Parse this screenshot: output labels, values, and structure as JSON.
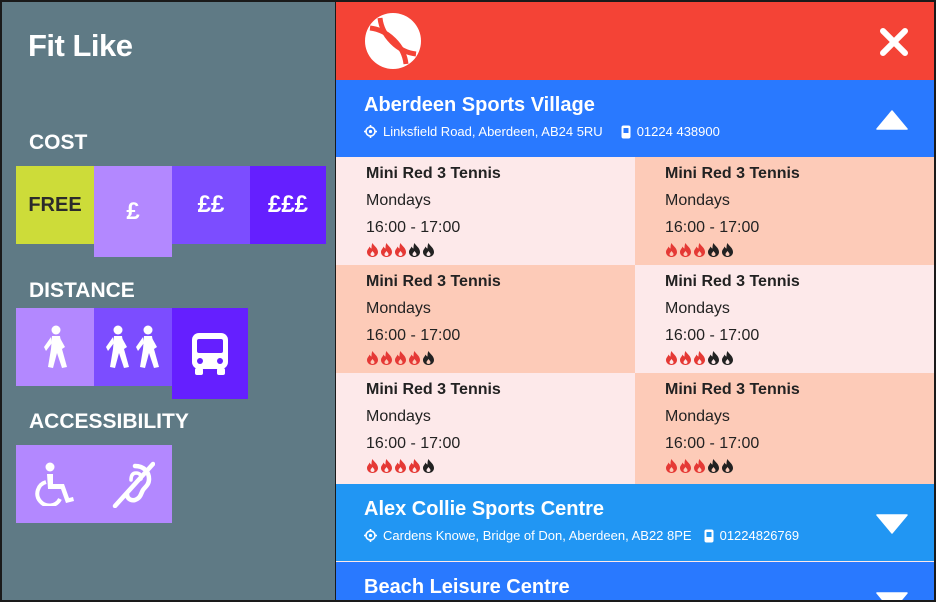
{
  "app": {
    "logo_text": "Fit Like"
  },
  "filters": {
    "cost": {
      "title": "COST",
      "options": [
        {
          "label": "FREE",
          "color": "#cddc39",
          "text_color": "#2b2b2b"
        },
        {
          "label": "£",
          "color": "#b388ff"
        },
        {
          "label": "££",
          "color": "#7c4dff"
        },
        {
          "label": "£££",
          "color": "#651fff"
        }
      ]
    },
    "distance": {
      "title": "DISTANCE",
      "options": [
        {
          "icon": "walking-person-icon",
          "color": "#b388ff"
        },
        {
          "icon": "two-walkers-icon",
          "color": "#7c4dff"
        },
        {
          "icon": "bus-icon",
          "color": "#651fff"
        }
      ]
    },
    "accessibility": {
      "title": "ACCESSIBILITY",
      "options": [
        {
          "icon": "wheelchair-icon",
          "color": "#b388ff"
        },
        {
          "icon": "hearing-loop-icon",
          "color": "#b388ff"
        }
      ]
    }
  },
  "header": {
    "sport_icon": "tennis-ball-icon",
    "close_icon": "close-icon",
    "color": "#f44336"
  },
  "venues": [
    {
      "name": "Aberdeen Sports Village",
      "address": "Linksfield Road, Aberdeen, AB24 5RU",
      "phone": "01224 438900",
      "expanded": true,
      "sessions": [
        {
          "name": "Mini Red 3 Tennis",
          "day": "Mondays",
          "time": "16:00 - 17:00",
          "intensity": 3,
          "max": 5
        },
        {
          "name": "Mini Red 3 Tennis",
          "day": "Mondays",
          "time": "16:00 - 17:00",
          "intensity": 3,
          "max": 5
        },
        {
          "name": "Mini Red 3 Tennis",
          "day": "Mondays",
          "time": "16:00 - 17:00",
          "intensity": 4,
          "max": 5
        },
        {
          "name": "Mini Red 3 Tennis",
          "day": "Mondays",
          "time": "16:00 - 17:00",
          "intensity": 3,
          "max": 5
        },
        {
          "name": "Mini Red 3 Tennis",
          "day": "Mondays",
          "time": "16:00 - 17:00",
          "intensity": 4,
          "max": 5
        },
        {
          "name": "Mini Red 3 Tennis",
          "day": "Mondays",
          "time": "16:00 - 17:00",
          "intensity": 3,
          "max": 5
        }
      ]
    },
    {
      "name": "Alex Collie Sports Centre",
      "address": "Cardens Knowe, Bridge of Don, Aberdeen, AB22 8PE",
      "phone": "01224826769",
      "expanded": false
    },
    {
      "name": "Beach Leisure Centre",
      "expanded": false
    }
  ],
  "colors": {
    "sidebar": "#5f7a85",
    "venue_active": "#2979ff",
    "venue_inactive": "#2196f3",
    "session_light": "#fde9ea",
    "session_peach": "#fdcbb8",
    "flame_on": "#e53935",
    "flame_off": "#222222"
  }
}
